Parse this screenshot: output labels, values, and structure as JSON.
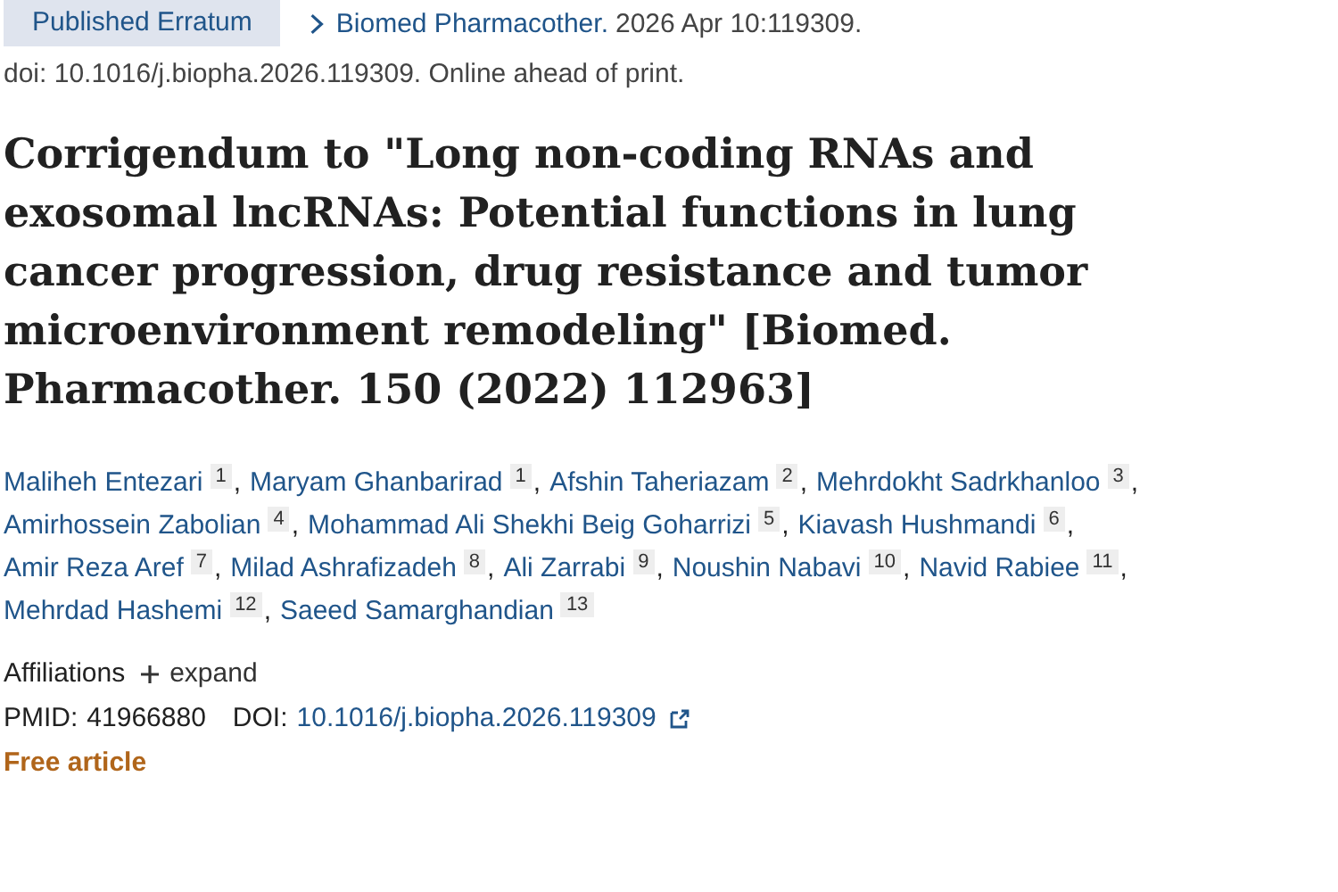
{
  "article_type": "Published Erratum",
  "citation": {
    "journal": "Biomed Pharmacother.",
    "details": "2026 Apr 10:119309."
  },
  "doi_line": "doi: 10.1016/j.biopha.2026.119309. Online ahead of print.",
  "title": "Corrigendum to \"Long non-coding RNAs and exosomal lncRNAs: Potential functions in lung cancer progression, drug resistance and tumor microenvironment remodeling\" [Biomed. Pharmacother. 150 (2022) 112963]",
  "authors": [
    {
      "name": "Maliheh Entezari",
      "affiliation": "1",
      "separator": ","
    },
    {
      "name": "Maryam Ghanbarirad",
      "affiliation": "1",
      "separator": ","
    },
    {
      "name": "Afshin Taheriazam",
      "affiliation": "2",
      "separator": ","
    },
    {
      "name": "Mehrdokht Sadrkhanloo",
      "affiliation": "3",
      "separator": ","
    },
    {
      "name": "Amirhossein Zabolian",
      "affiliation": "4",
      "separator": ","
    },
    {
      "name": "Mohammad Ali Shekhi Beig Goharrizi",
      "affiliation": "5",
      "separator": ","
    },
    {
      "name": "Kiavash Hushmandi",
      "affiliation": "6",
      "separator": ","
    },
    {
      "name": "Amir Reza Aref",
      "affiliation": "7",
      "separator": ","
    },
    {
      "name": "Milad Ashrafizadeh",
      "affiliation": "8",
      "separator": ","
    },
    {
      "name": "Ali Zarrabi",
      "affiliation": "9",
      "separator": ","
    },
    {
      "name": "Noushin Nabavi",
      "affiliation": "10",
      "separator": ","
    },
    {
      "name": "Navid Rabiee",
      "affiliation": "11",
      "separator": ","
    },
    {
      "name": "Mehrdad Hashemi",
      "affiliation": "12",
      "separator": ","
    },
    {
      "name": "Saeed Samarghandian",
      "affiliation": "13"
    }
  ],
  "affiliations": {
    "label": "Affiliations",
    "toggle": "expand",
    "expanded": false
  },
  "identifiers": {
    "pmid_label": "PMID:",
    "pmid": "41966880",
    "doi_label": "DOI:",
    "doi": "10.1016/j.biopha.2026.119309"
  },
  "access": "Free article"
}
